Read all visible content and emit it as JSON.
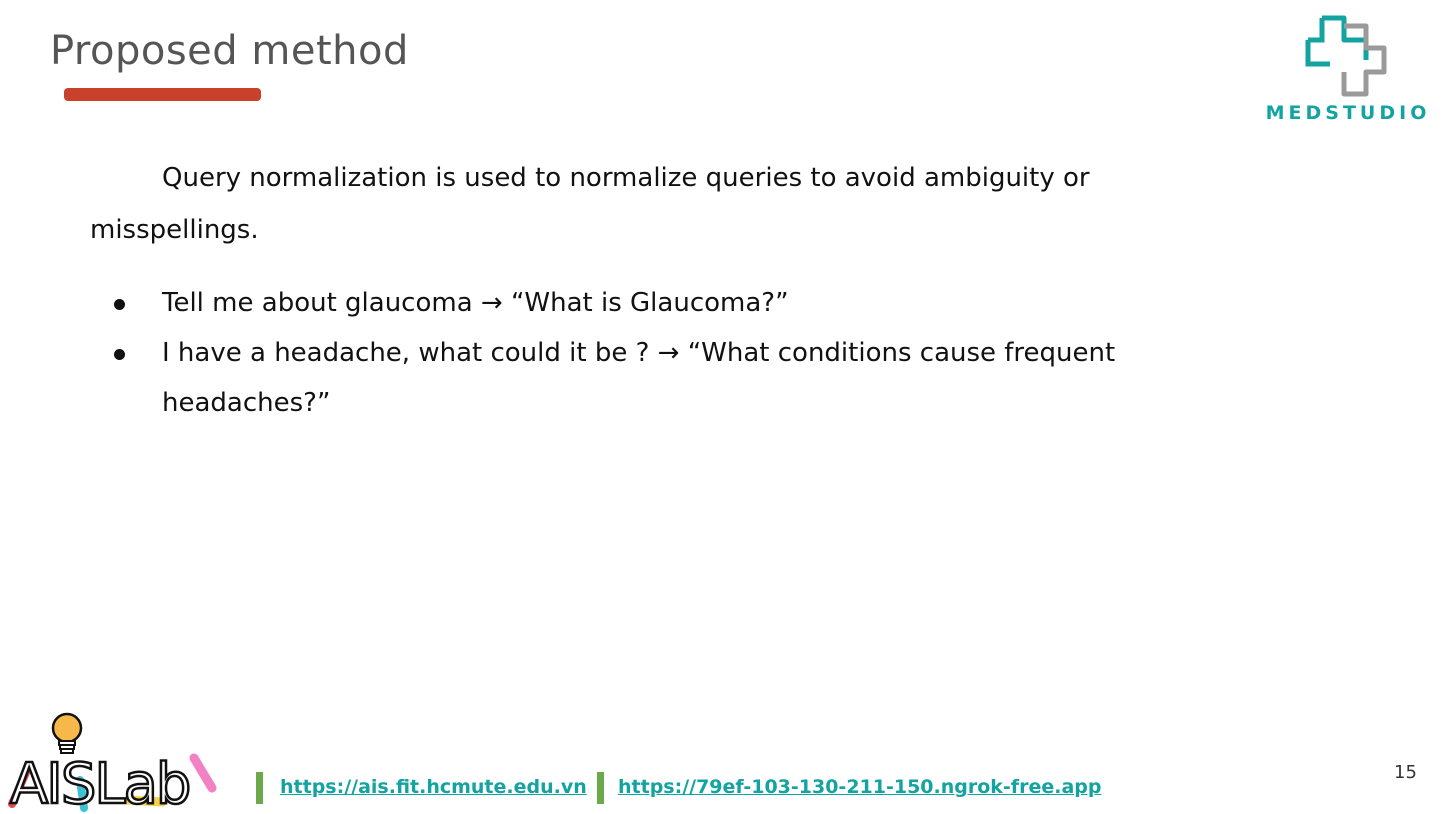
{
  "slide": {
    "title": "Proposed method",
    "brand": {
      "name": "MEDSTUDIO",
      "teal": "#13a3a0",
      "gray": "#9a9a9a"
    },
    "accent_color": "#c8412a",
    "paragraph": "Query normalization is used to normalize queries to avoid ambiguity or misspellings.",
    "bullets": [
      "Tell me about glaucoma → “What is Glaucoma?”",
      "I have a headache, what could it be ? → “What conditions cause frequent headaches?”"
    ],
    "footer": {
      "lab_logo_text": "AISLab",
      "link_1": "https://ais.fit.hcmute.edu.vn",
      "link_2": "https://79ef-103-130-211-150.ngrok-free.app",
      "divider_color": "#6aaa4a"
    },
    "page_number": "15"
  }
}
